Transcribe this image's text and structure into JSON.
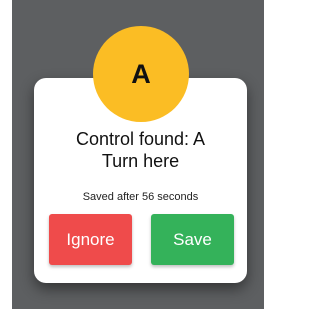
{
  "dialog": {
    "badge_letter": "A",
    "title_line1": "Control found: A",
    "title_line2": "Turn here",
    "status_text": "Saved after 56 seconds",
    "ignore_label": "Ignore",
    "save_label": "Save"
  },
  "colors": {
    "badge": "#fbbd24",
    "ignore": "#ef4b4b",
    "save": "#34b25a",
    "backdrop": "#5d5f61"
  }
}
